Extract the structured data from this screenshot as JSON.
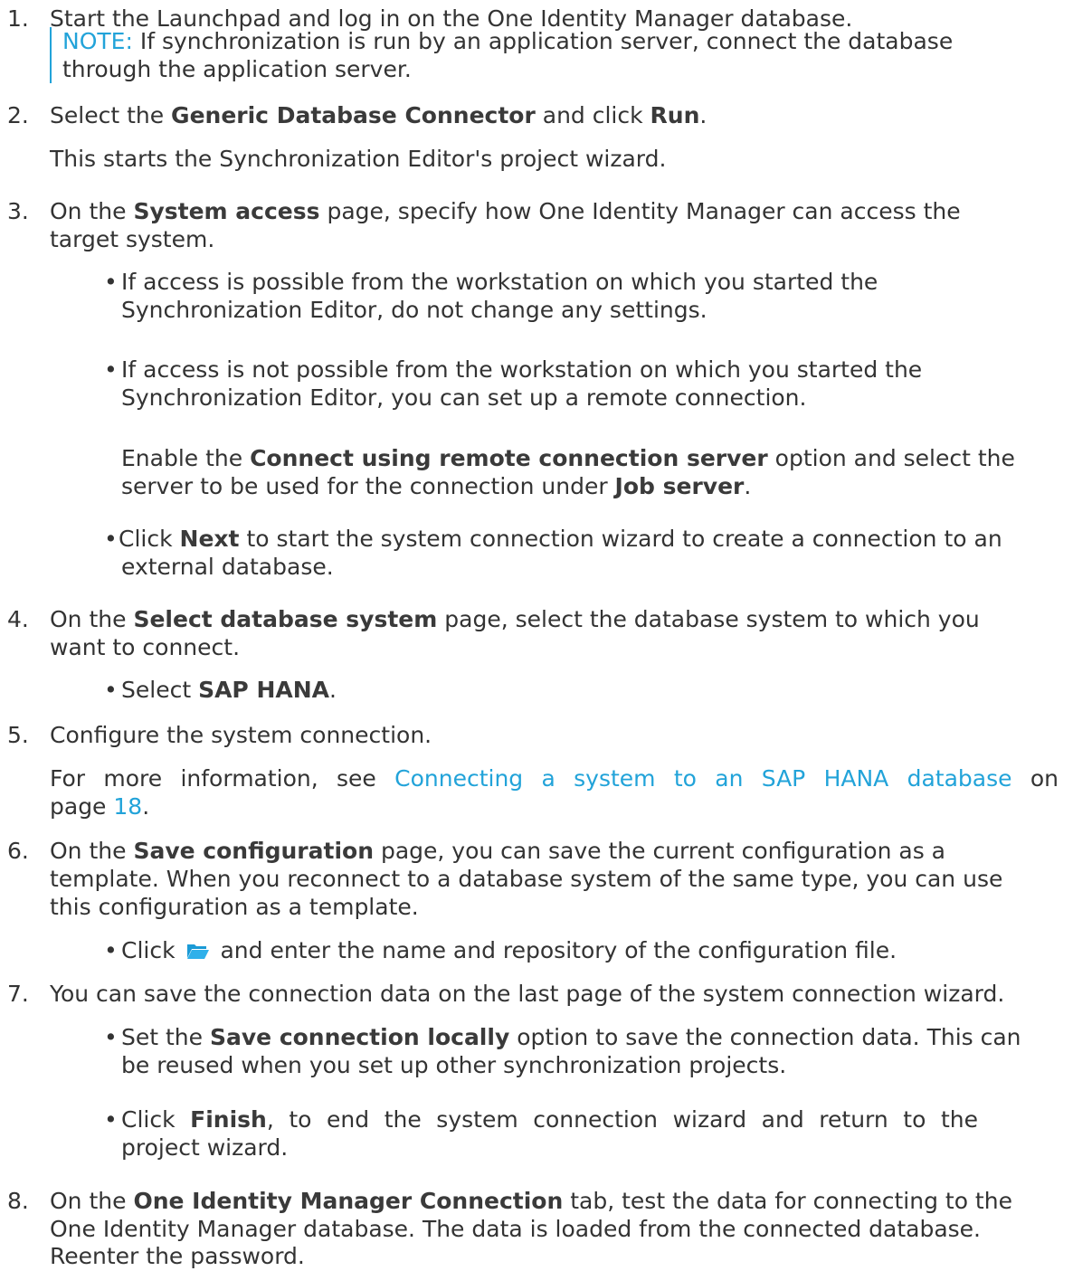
{
  "steps": [
    {
      "number": "1.",
      "text": "Start the Launchpad and log in on the One Identity Manager database."
    },
    {
      "note_label": "NOTE:",
      "note_line1": " If synchronization is run by an application server, connect the database",
      "note_line2": "through the application server."
    },
    {
      "number": "2.",
      "t1": "Select the ",
      "b1": "Generic Database Connector",
      "t2": " and click ",
      "b2": "Run",
      "t3": ".",
      "sub": "This starts the Synchronization Editor's project wizard."
    },
    {
      "number": "3.",
      "t1": "On the ",
      "b1": "System access",
      "t2": " page, specify how One Identity Manager can access the",
      "line2": "target system.",
      "bullet1_l1": "If access is possible from the workstation on which you started the",
      "bullet1_l2": "Synchronization Editor, do not change any settings.",
      "bullet2_l1": "If access is not possible from the workstation on which you started the",
      "bullet2_l2": "Synchronization Editor, you can set up a remote connection.",
      "p_t1": "Enable the ",
      "p_b1": "Connect using remote connection server",
      "p_t2": " option and select the",
      "p_l2_t1": "server to be used for the connection under ",
      "p_l2_b1": "Job server",
      "p_l2_t2": ".",
      "bullet3_t1": "Click ",
      "bullet3_b1": "Next",
      "bullet3_t2": " to start the system connection wizard to create a connection to an",
      "bullet3_l2": "external database."
    },
    {
      "number": "4.",
      "t1": "On the ",
      "b1": "Select database system",
      "t2": " page, select the database system to which you",
      "line2": "want to connect.",
      "bullet1_t1": "Select ",
      "bullet1_b1": "SAP HANA",
      "bullet1_t2": "."
    },
    {
      "number": "5.",
      "text": "Configure the system connection.",
      "sub_t1": "For more information, see ",
      "sub_link": "Connecting a system to an SAP HANA database",
      "sub_t2": " on",
      "sub_l2_t1": "page ",
      "sub_l2_link": "18",
      "sub_l2_t2": "."
    },
    {
      "number": "6.",
      "t1": "On the ",
      "b1": "Save configuration",
      "t2": " page, you can save the current configuration as a",
      "line2": "template. When you reconnect to a database system of the same type, you can use",
      "line3": "this configuration as a template.",
      "bullet1_t1": "Click ",
      "bullet1_t2": " and enter the name and repository of the configuration file."
    },
    {
      "number": "7.",
      "text": "You can save the connection data on the last page of the system connection wizard.",
      "bullet1_t1": "Set the ",
      "bullet1_b1": "Save connection locally",
      "bullet1_t2": " option to save the connection data. This can",
      "bullet1_l2": "be reused when you set up other synchronization projects.",
      "bullet2_t1": "Click ",
      "bullet2_b1": "Finish",
      "bullet2_t2": ", to end the system connection wizard and return to the",
      "bullet2_l2": "project wizard."
    },
    {
      "number": "8.",
      "t1": "On the ",
      "b1": "One Identity Manager Connection",
      "t2": " tab, test the data for connecting to the",
      "line2": "One Identity Manager database. The data is loaded from the connected database.",
      "line3": "Reenter the password."
    }
  ],
  "bullet_char": "•",
  "colors": {
    "link": "#22a3d9",
    "text": "#333333",
    "icon_folder": "#1a9ad6"
  },
  "icons": {
    "folder": "folder-open-icon"
  }
}
